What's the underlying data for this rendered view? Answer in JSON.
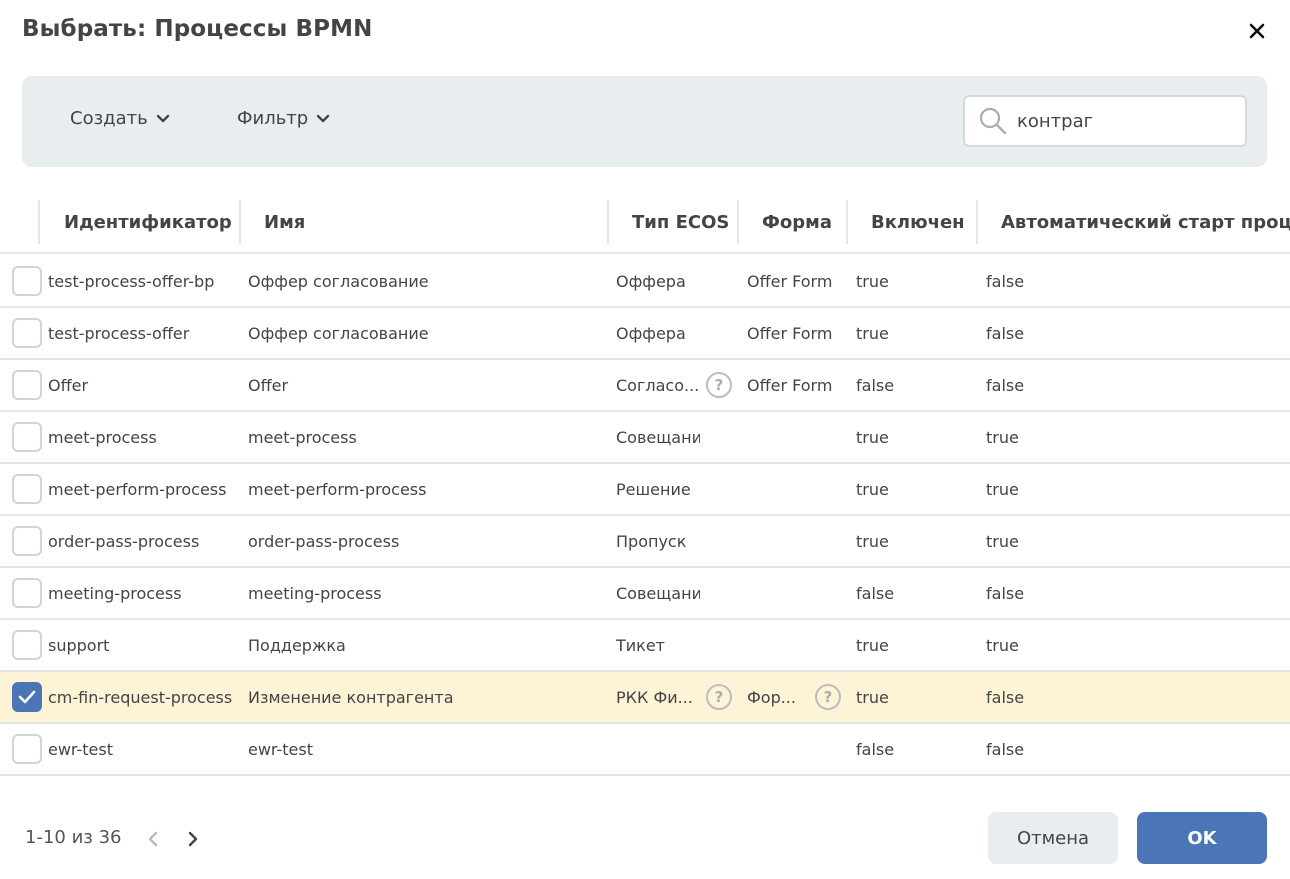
{
  "dialog": {
    "title": "Выбрать: Процессы BPMN"
  },
  "toolbar": {
    "create_label": "Создать",
    "filter_label": "Фильтр",
    "search_value": "контраг"
  },
  "table": {
    "columns": {
      "id": "Идентификатор",
      "name": "Имя",
      "ecos_type": "Тип ECOS",
      "form": "Форма",
      "enabled": "Включен",
      "autostart": "Автоматический старт процесса"
    },
    "rows": [
      {
        "id": "test-process-offer-bp",
        "name": "Оффер согласование",
        "ecos_type": "Оффера",
        "ecos_help": false,
        "form": "Offer Form",
        "form_help": false,
        "enabled": "true",
        "autostart": "false",
        "checked": false
      },
      {
        "id": "test-process-offer",
        "name": "Оффер согласование",
        "ecos_type": "Оффера",
        "ecos_help": false,
        "form": "Offer Form",
        "form_help": false,
        "enabled": "true",
        "autostart": "false",
        "checked": false
      },
      {
        "id": "Offer",
        "name": "Offer",
        "ecos_type": "Согласо...",
        "ecos_help": true,
        "form": "Offer Form",
        "form_help": false,
        "enabled": "false",
        "autostart": "false",
        "checked": false
      },
      {
        "id": "meet-process",
        "name": "meet-process",
        "ecos_type": "Совещание",
        "ecos_help": false,
        "form": "",
        "form_help": false,
        "enabled": "true",
        "autostart": "true",
        "checked": false
      },
      {
        "id": "meet-perform-process",
        "name": "meet-perform-process",
        "ecos_type": "Решение",
        "ecos_help": false,
        "form": "",
        "form_help": false,
        "enabled": "true",
        "autostart": "true",
        "checked": false
      },
      {
        "id": "order-pass-process",
        "name": "order-pass-process",
        "ecos_type": "Пропуск",
        "ecos_help": false,
        "form": "",
        "form_help": false,
        "enabled": "true",
        "autostart": "true",
        "checked": false
      },
      {
        "id": "meeting-process",
        "name": "meeting-process",
        "ecos_type": "Совещание",
        "ecos_help": false,
        "form": "",
        "form_help": false,
        "enabled": "false",
        "autostart": "false",
        "checked": false
      },
      {
        "id": "support",
        "name": "Поддержка",
        "ecos_type": "Тикет",
        "ecos_help": false,
        "form": "",
        "form_help": false,
        "enabled": "true",
        "autostart": "true",
        "checked": false
      },
      {
        "id": "cm-fin-request-process",
        "name": "Изменение контрагента",
        "ecos_type": "РКК Фи...",
        "ecos_help": true,
        "form": "Фор...",
        "form_help": true,
        "enabled": "true",
        "autostart": "false",
        "checked": true
      },
      {
        "id": "ewr-test",
        "name": "ewr-test",
        "ecos_type": "",
        "ecos_help": false,
        "form": "",
        "form_help": false,
        "enabled": "false",
        "autostart": "false",
        "checked": false
      }
    ]
  },
  "pagination": {
    "text": "1-10 из 36"
  },
  "footer": {
    "cancel_label": "Отмена",
    "ok_label": "OK"
  },
  "colors": {
    "accent": "#4a75b7",
    "toolbar_bg": "#e8edf0",
    "selected_row": "#fdf3d7"
  }
}
